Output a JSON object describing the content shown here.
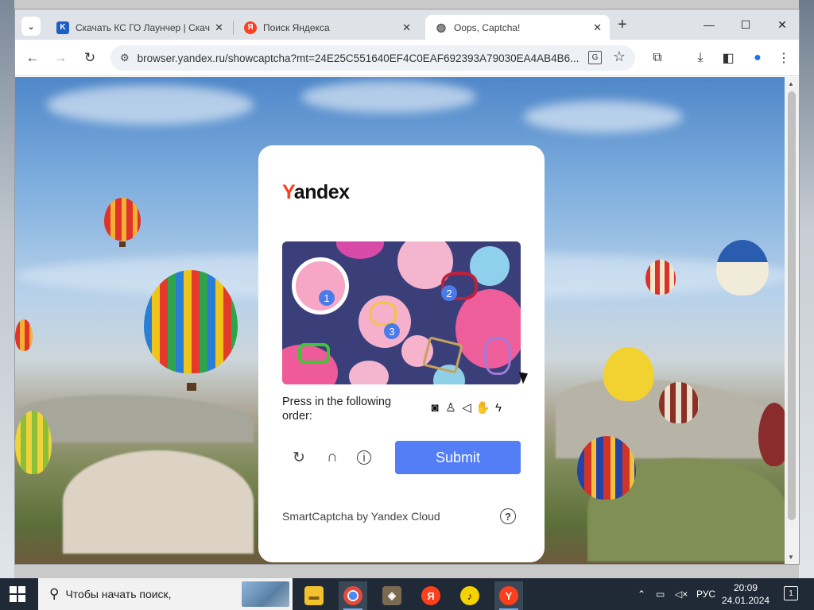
{
  "browser": {
    "tabs": [
      {
        "title": "Скачать КС ГО Лаунчер | Скач",
        "favicon": "kc-icon",
        "active": false
      },
      {
        "title": "Поиск Яндекса",
        "favicon": "yandex-icon",
        "active": false
      },
      {
        "title": "Oops, Captcha!",
        "favicon": "globe-icon",
        "active": true
      }
    ],
    "tab_close": "✕",
    "new_tab": "+",
    "window_controls": {
      "minimize": "—",
      "maximize": "☐",
      "close": "✕"
    },
    "url": "browser.yandex.ru/showcaptcha?mt=24E25C551640EF4C0EAF692393A79030EA4AB4B6..."
  },
  "captcha": {
    "logo_first": "Y",
    "logo_rest": "andex",
    "task_numbers": [
      "1",
      "2",
      "3"
    ],
    "instruction": "Press in the following order:",
    "order_icons": [
      "camera-icon",
      "person-icon",
      "speaker-icon",
      "hand-icon",
      "lightning-icon"
    ],
    "submit_label": "Submit",
    "footer": "SmartCaptcha by Yandex Cloud",
    "help": "?"
  },
  "taskbar": {
    "search_placeholder": "Чтобы начать поиск,",
    "apps": [
      "file-explorer-icon",
      "chrome-icon",
      "game-icon",
      "yandex-icon",
      "yandex-music-icon",
      "yandex-browser-icon"
    ],
    "language": "РУС",
    "time": "20:09",
    "date": "24.01.2024",
    "notifications": "1"
  },
  "colors": {
    "accent": "#537ef5",
    "yandex_red": "#fc3f1d",
    "taskbar": "#1f2a36"
  }
}
